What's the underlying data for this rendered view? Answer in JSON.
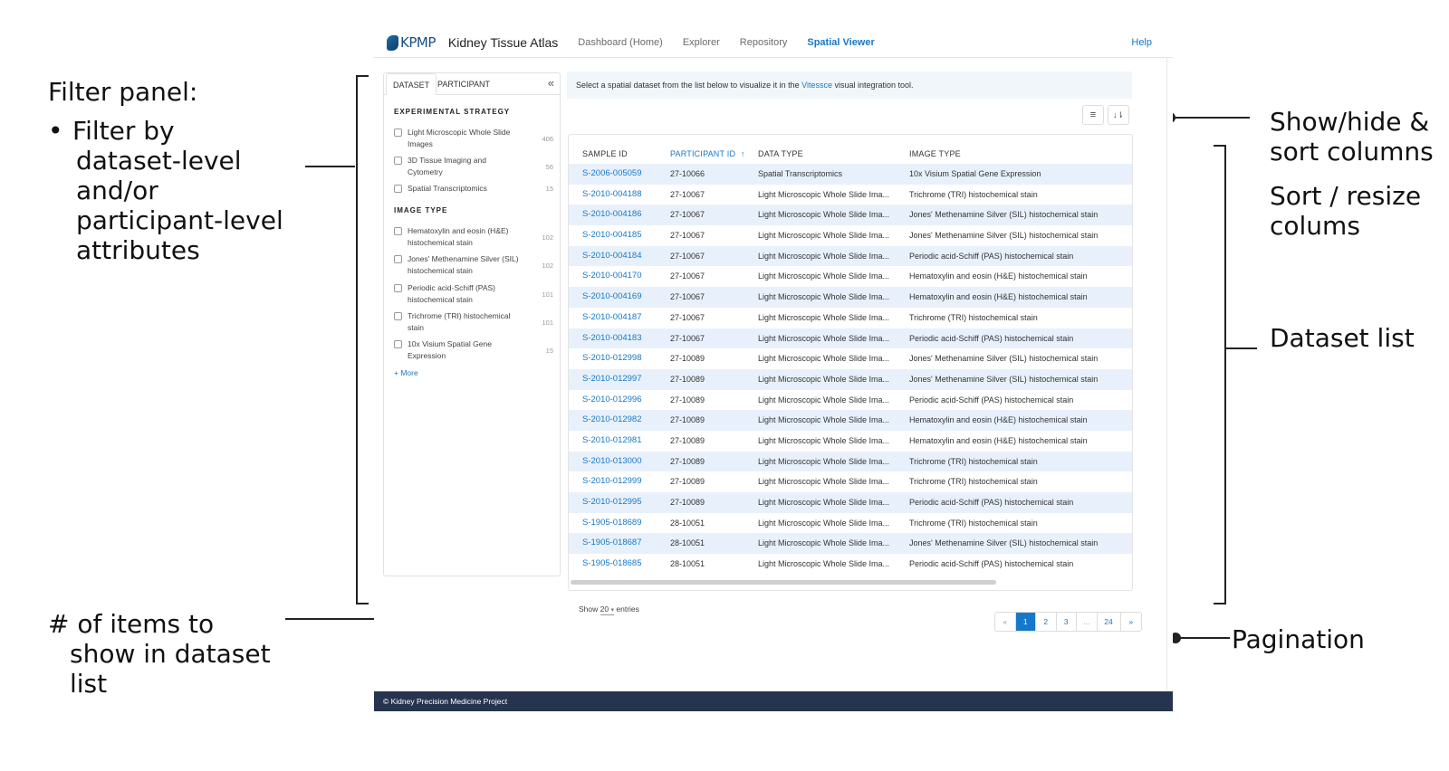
{
  "annotations": {
    "filter_panel_title": "Filter panel:",
    "filter_panel_bullet": "•",
    "filter_panel_lines": [
      "Filter by",
      "dataset-level",
      "and/or",
      "participant-level",
      "attributes"
    ],
    "items_to_show_lines": [
      "# of items to",
      "show in dataset",
      "list"
    ],
    "show_hide_lines": [
      "Show/hide &",
      "sort columns"
    ],
    "sort_resize_lines": [
      "Sort / resize",
      "colums"
    ],
    "dataset_list": "Dataset list",
    "pagination": "Pagination"
  },
  "nav": {
    "logo_text": "KPMP",
    "app_title": "Kidney Tissue Atlas",
    "items": [
      "Dashboard (Home)",
      "Explorer",
      "Repository",
      "Spatial Viewer"
    ],
    "active_item": "Spatial Viewer",
    "help": "Help"
  },
  "filter_panel": {
    "tabs": [
      "DATASET",
      "PARTICIPANT"
    ],
    "collapse_glyph": "«",
    "sections": [
      {
        "title": "EXPERIMENTAL STRATEGY",
        "options": [
          {
            "label": "Light Microscopic Whole Slide Images",
            "count": "406"
          },
          {
            "label": "3D Tissue Imaging and Cytometry",
            "count": "56"
          },
          {
            "label": "Spatial Transcriptomics",
            "count": "15"
          }
        ]
      },
      {
        "title": "IMAGE TYPE",
        "options": [
          {
            "label": "Hematoxylin and eosin (H&E) histochemical stain",
            "count": "102"
          },
          {
            "label": "Jones' Methenamine Silver (SIL) histochemical stain",
            "count": "102"
          },
          {
            "label": "Periodic acid-Schiff (PAS) histochemical stain",
            "count": "101"
          },
          {
            "label": "Trichrome (TRI) histochemical stain",
            "count": "101"
          },
          {
            "label": "10x Visium Spatial Gene Expression",
            "count": "15"
          }
        ]
      }
    ],
    "more_link": "+ More"
  },
  "info_bar": {
    "text_before": "Select a spatial dataset from the list below to visualize it in the ",
    "link": "Vitessce",
    "text_after": " visual integration tool."
  },
  "toolbar": {
    "columns_icon": "≡",
    "sort_icon": "↓⇂"
  },
  "table": {
    "headers": [
      "SAMPLE ID",
      "PARTICIPANT ID",
      "DATA TYPE",
      "IMAGE TYPE"
    ],
    "sort_arrow": "↑",
    "rows": [
      [
        "S-2006-005059",
        "27-10066",
        "Spatial Transcriptomics",
        "10x Visium Spatial Gene Expression"
      ],
      [
        "S-2010-004188",
        "27-10067",
        "Light Microscopic Whole Slide Ima...",
        "Trichrome (TRI) histochemical stain"
      ],
      [
        "S-2010-004186",
        "27-10067",
        "Light Microscopic Whole Slide Ima...",
        "Jones' Methenamine Silver (SIL) histochemical stain"
      ],
      [
        "S-2010-004185",
        "27-10067",
        "Light Microscopic Whole Slide Ima...",
        "Jones' Methenamine Silver (SIL) histochemical stain"
      ],
      [
        "S-2010-004184",
        "27-10067",
        "Light Microscopic Whole Slide Ima...",
        "Periodic acid-Schiff (PAS) histochemical stain"
      ],
      [
        "S-2010-004170",
        "27-10067",
        "Light Microscopic Whole Slide Ima...",
        "Hematoxylin and eosin (H&E) histochemical stain"
      ],
      [
        "S-2010-004169",
        "27-10067",
        "Light Microscopic Whole Slide Ima...",
        "Hematoxylin and eosin (H&E) histochemical stain"
      ],
      [
        "S-2010-004187",
        "27-10067",
        "Light Microscopic Whole Slide Ima...",
        "Trichrome (TRI) histochemical stain"
      ],
      [
        "S-2010-004183",
        "27-10067",
        "Light Microscopic Whole Slide Ima...",
        "Periodic acid-Schiff (PAS) histochemical stain"
      ],
      [
        "S-2010-012998",
        "27-10089",
        "Light Microscopic Whole Slide Ima...",
        "Jones' Methenamine Silver (SIL) histochemical stain"
      ],
      [
        "S-2010-012997",
        "27-10089",
        "Light Microscopic Whole Slide Ima...",
        "Jones' Methenamine Silver (SIL) histochemical stain"
      ],
      [
        "S-2010-012996",
        "27-10089",
        "Light Microscopic Whole Slide Ima...",
        "Periodic acid-Schiff (PAS) histochemical stain"
      ],
      [
        "S-2010-012982",
        "27-10089",
        "Light Microscopic Whole Slide Ima...",
        "Hematoxylin and eosin (H&E) histochemical stain"
      ],
      [
        "S-2010-012981",
        "27-10089",
        "Light Microscopic Whole Slide Ima...",
        "Hematoxylin and eosin (H&E) histochemical stain"
      ],
      [
        "S-2010-013000",
        "27-10089",
        "Light Microscopic Whole Slide Ima...",
        "Trichrome (TRI) histochemical stain"
      ],
      [
        "S-2010-012999",
        "27-10089",
        "Light Microscopic Whole Slide Ima...",
        "Trichrome (TRI) histochemical stain"
      ],
      [
        "S-2010-012995",
        "27-10089",
        "Light Microscopic Whole Slide Ima...",
        "Periodic acid-Schiff (PAS) histochemical stain"
      ],
      [
        "S-1905-018689",
        "28-10051",
        "Light Microscopic Whole Slide Ima...",
        "Trichrome (TRI) histochemical stain"
      ],
      [
        "S-1905-018687",
        "28-10051",
        "Light Microscopic Whole Slide Ima...",
        "Jones' Methenamine Silver (SIL) histochemical stain"
      ],
      [
        "S-1905-018685",
        "28-10051",
        "Light Microscopic Whole Slide Ima...",
        "Periodic acid-Schiff (PAS) histochemical stain"
      ]
    ]
  },
  "entries": {
    "prefix": "Show",
    "value": "20",
    "caret": "▾",
    "suffix": "entries"
  },
  "pagination": {
    "items": [
      "«",
      "1",
      "2",
      "3",
      "...",
      "24",
      "»"
    ],
    "active": "1"
  },
  "footer": "© Kidney Precision Medicine Project",
  "colors": {
    "accent": "#1678c8",
    "row_stripe": "#e8f1fb",
    "footer_bg": "#26344f",
    "info_bg": "#f1f6fa"
  }
}
